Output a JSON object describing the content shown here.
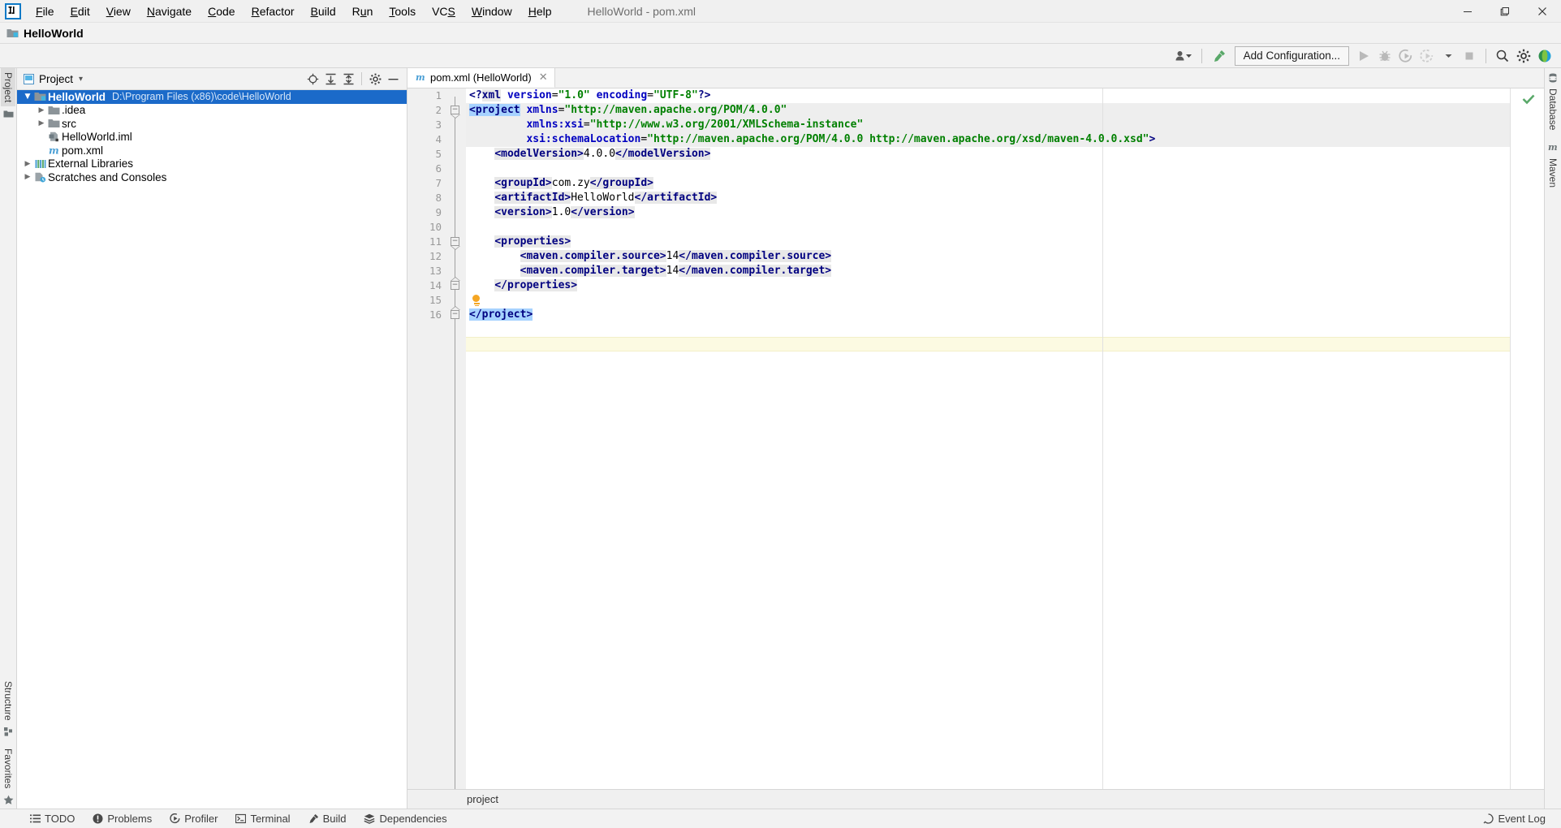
{
  "window": {
    "title": "HelloWorld - pom.xml",
    "minimize_label": "—",
    "maximize_label": "❐",
    "close_label": "✕"
  },
  "menu": {
    "items": [
      {
        "label": "File",
        "mnemonic": "F"
      },
      {
        "label": "Edit",
        "mnemonic": "E"
      },
      {
        "label": "View",
        "mnemonic": "V"
      },
      {
        "label": "Navigate",
        "mnemonic": "N"
      },
      {
        "label": "Code",
        "mnemonic": "C"
      },
      {
        "label": "Refactor",
        "mnemonic": "R"
      },
      {
        "label": "Build",
        "mnemonic": "B"
      },
      {
        "label": "Run",
        "mnemonic": "u"
      },
      {
        "label": "Tools",
        "mnemonic": "T"
      },
      {
        "label": "VCS",
        "mnemonic": "S"
      },
      {
        "label": "Window",
        "mnemonic": "W"
      },
      {
        "label": "Help",
        "mnemonic": "H"
      }
    ]
  },
  "namebar": {
    "project_name": "HelloWorld"
  },
  "toolbar": {
    "run_config_label": "Add Configuration...",
    "icons": [
      "user-avatar-icon",
      "build-hammer-icon",
      "run-icon",
      "debug-icon",
      "run-coverage-icon",
      "profiler-icon",
      "stop-icon",
      "search-everywhere-icon",
      "settings-gear-icon",
      "updates-icon"
    ]
  },
  "left_strip": {
    "top": [
      {
        "label": "Project",
        "selected": true
      }
    ],
    "bottom": [
      {
        "label": "Structure",
        "selected": false
      },
      {
        "label": "Favorites",
        "selected": false
      }
    ]
  },
  "right_strip": {
    "items": [
      {
        "label": "Database"
      },
      {
        "label": "Maven"
      }
    ]
  },
  "project_panel": {
    "title": "Project",
    "dropdown_glyph": "▾",
    "toolbar_icons": [
      "locate-icon",
      "expand-all-icon",
      "collapse-all-icon",
      "settings-gear-icon",
      "hide-icon"
    ],
    "tree": [
      {
        "depth": 0,
        "arrow": "expanded",
        "icon": "module-folder-icon",
        "name": "HelloWorld",
        "path": "D:\\Program Files (x86)\\code\\HelloWorld",
        "selected": true,
        "bold": true
      },
      {
        "depth": 1,
        "arrow": "collapsed",
        "icon": "folder-icon",
        "name": ".idea",
        "path": "",
        "selected": false,
        "bold": false
      },
      {
        "depth": 1,
        "arrow": "collapsed",
        "icon": "folder-icon",
        "name": "src",
        "path": "",
        "selected": false,
        "bold": false
      },
      {
        "depth": 1,
        "arrow": "none",
        "icon": "iml-file-icon",
        "name": "HelloWorld.iml",
        "path": "",
        "selected": false,
        "bold": false
      },
      {
        "depth": 1,
        "arrow": "none",
        "icon": "maven-pom-icon",
        "name": "pom.xml",
        "path": "",
        "selected": false,
        "bold": false
      },
      {
        "depth": 0,
        "arrow": "collapsed",
        "icon": "libraries-icon",
        "name": "External Libraries",
        "path": "",
        "selected": false,
        "bold": false
      },
      {
        "depth": 0,
        "arrow": "collapsed",
        "icon": "scratches-icon",
        "name": "Scratches and Consoles",
        "path": "",
        "selected": false,
        "bold": false
      }
    ]
  },
  "editor": {
    "tab": {
      "icon": "maven-pom-icon",
      "label": "pom.xml (HelloWorld)",
      "close_glyph": "✕"
    },
    "breadcrumb": "project",
    "inspection_status": "ok-checkmark",
    "line_numbers": [
      1,
      2,
      3,
      4,
      5,
      6,
      7,
      8,
      9,
      10,
      11,
      12,
      13,
      14,
      15,
      16
    ],
    "current_line": 16,
    "lines": [
      {
        "n": 1,
        "tokens": [
          {
            "t": "<?",
            "c": "pi"
          },
          {
            "t": "xml",
            "c": "tagh"
          },
          {
            "t": " ",
            "c": "txt"
          },
          {
            "t": "version",
            "c": "attr"
          },
          {
            "t": "=",
            "c": "txt"
          },
          {
            "t": "\"1.0\"",
            "c": "val"
          },
          {
            "t": " ",
            "c": "txt"
          },
          {
            "t": "encoding",
            "c": "attr"
          },
          {
            "t": "=",
            "c": "txt"
          },
          {
            "t": "\"UTF-8\"",
            "c": "val"
          },
          {
            "t": "?>",
            "c": "pi"
          }
        ]
      },
      {
        "n": 2,
        "tokens": [
          {
            "t": "<project",
            "c": "sel-tag"
          },
          {
            "t": " ",
            "c": "txt"
          },
          {
            "t": "xmlns",
            "c": "attr"
          },
          {
            "t": "=",
            "c": "txt"
          },
          {
            "t": "\"http://maven.apache.org/POM/4.0.0\"",
            "c": "val"
          }
        ]
      },
      {
        "n": 3,
        "tokens": [
          {
            "t": "         ",
            "c": "txt"
          },
          {
            "t": "xmlns:xsi",
            "c": "attr"
          },
          {
            "t": "=",
            "c": "txt"
          },
          {
            "t": "\"http://www.w3.org/2001/XMLSchema-instance\"",
            "c": "val"
          }
        ]
      },
      {
        "n": 4,
        "tokens": [
          {
            "t": "         ",
            "c": "txt"
          },
          {
            "t": "xsi:schemaLocation",
            "c": "attr"
          },
          {
            "t": "=",
            "c": "txt"
          },
          {
            "t": "\"http://maven.apache.org/POM/4.0.0 http://maven.apache.org/xsd/maven-4.0.0.xsd\"",
            "c": "val"
          },
          {
            "t": ">",
            "c": "tag"
          }
        ]
      },
      {
        "n": 5,
        "tokens": [
          {
            "t": "    ",
            "c": "txt"
          },
          {
            "t": "<modelVersion>",
            "c": "tagh"
          },
          {
            "t": "4.0.0",
            "c": "txt"
          },
          {
            "t": "</modelVersion>",
            "c": "tagh"
          }
        ]
      },
      {
        "n": 6,
        "tokens": []
      },
      {
        "n": 7,
        "tokens": [
          {
            "t": "    ",
            "c": "txt"
          },
          {
            "t": "<groupId>",
            "c": "tagh"
          },
          {
            "t": "com.zy",
            "c": "txt"
          },
          {
            "t": "</groupId>",
            "c": "tagh"
          }
        ]
      },
      {
        "n": 8,
        "tokens": [
          {
            "t": "    ",
            "c": "txt"
          },
          {
            "t": "<artifactId>",
            "c": "tagh"
          },
          {
            "t": "HelloWorld",
            "c": "txt"
          },
          {
            "t": "</artifactId>",
            "c": "tagh"
          }
        ]
      },
      {
        "n": 9,
        "tokens": [
          {
            "t": "    ",
            "c": "txt"
          },
          {
            "t": "<version>",
            "c": "tagh"
          },
          {
            "t": "1.0",
            "c": "txt"
          },
          {
            "t": "</version>",
            "c": "tagh"
          }
        ]
      },
      {
        "n": 10,
        "tokens": []
      },
      {
        "n": 11,
        "tokens": [
          {
            "t": "    ",
            "c": "txt"
          },
          {
            "t": "<properties>",
            "c": "tagh"
          }
        ]
      },
      {
        "n": 12,
        "tokens": [
          {
            "t": "        ",
            "c": "txt"
          },
          {
            "t": "<maven.compiler.source>",
            "c": "tagh"
          },
          {
            "t": "14",
            "c": "txt"
          },
          {
            "t": "</maven.compiler.source>",
            "c": "tagh"
          }
        ]
      },
      {
        "n": 13,
        "tokens": [
          {
            "t": "        ",
            "c": "txt"
          },
          {
            "t": "<maven.compiler.target>",
            "c": "tagh"
          },
          {
            "t": "14",
            "c": "txt"
          },
          {
            "t": "</maven.compiler.target>",
            "c": "tagh"
          }
        ]
      },
      {
        "n": 14,
        "tokens": [
          {
            "t": "    ",
            "c": "txt"
          },
          {
            "t": "</properties>",
            "c": "tagh"
          }
        ]
      },
      {
        "n": 15,
        "tokens": []
      },
      {
        "n": 16,
        "tokens": [
          {
            "t": "</project>",
            "c": "sel-tag"
          }
        ]
      }
    ],
    "intention_bulb_line": 15,
    "fold_markers": [
      {
        "line": 2,
        "type": "open"
      },
      {
        "line": 11,
        "type": "open"
      },
      {
        "line": 14,
        "type": "close"
      },
      {
        "line": 16,
        "type": "close"
      }
    ]
  },
  "statusbar": {
    "left_items": [
      {
        "label": "TODO",
        "icon": "todo-list-icon"
      },
      {
        "label": "Problems",
        "icon": "problems-icon"
      },
      {
        "label": "Profiler",
        "icon": "profiler-icon"
      },
      {
        "label": "Terminal",
        "icon": "terminal-icon"
      },
      {
        "label": "Build",
        "icon": "build-hammer-icon"
      },
      {
        "label": "Dependencies",
        "icon": "dependencies-icon"
      }
    ],
    "right_items": [
      {
        "label": "Event Log",
        "icon": "event-log-icon"
      }
    ]
  },
  "colors": {
    "selection_blue": "#1b6ac9",
    "tag_navy": "#000080",
    "attr_blue": "#0000c0",
    "value_green": "#008000",
    "current_line_yellow": "#fcfae2",
    "block_highlight": "#eeeeee",
    "ok_green": "#59a869",
    "bulb_orange": "#f5a623"
  }
}
